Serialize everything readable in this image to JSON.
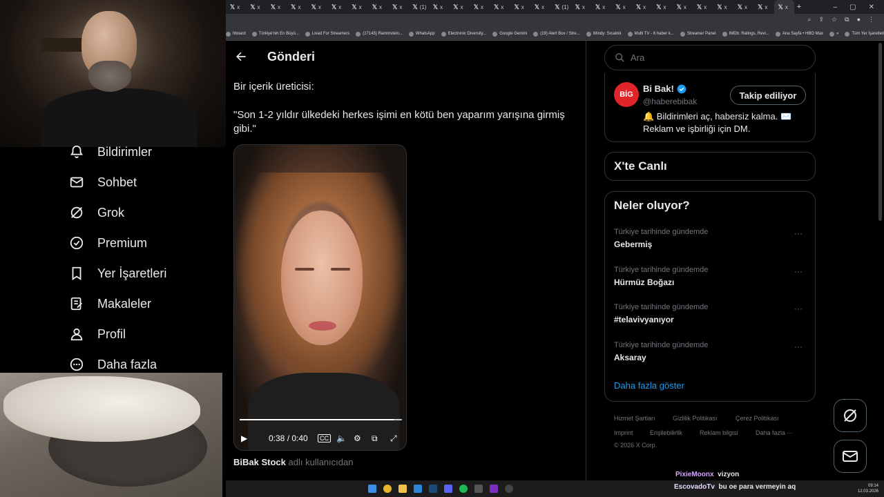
{
  "browser": {
    "tabs": [
      {
        "label": "x"
      },
      {
        "label": "x"
      },
      {
        "label": "x"
      },
      {
        "label": "x"
      },
      {
        "label": "x"
      },
      {
        "label": "x"
      },
      {
        "label": "x"
      },
      {
        "label": "x"
      },
      {
        "label": "x"
      },
      {
        "label": "(1)"
      },
      {
        "label": "x"
      },
      {
        "label": "x"
      },
      {
        "label": "x"
      },
      {
        "label": "x"
      },
      {
        "label": "x"
      },
      {
        "label": "x"
      },
      {
        "label": "(1)"
      },
      {
        "label": "x"
      },
      {
        "label": "x"
      },
      {
        "label": "x"
      },
      {
        "label": "x"
      },
      {
        "label": "x"
      },
      {
        "label": "x"
      },
      {
        "label": "x"
      },
      {
        "label": "x"
      },
      {
        "label": "x"
      },
      {
        "label": "x"
      },
      {
        "label": "x"
      }
    ],
    "bookmarks": [
      "hboard",
      "Türkiye'nin En Büyü...",
      "Livad For Streamers",
      "(17145) Rammstein...",
      "WhatsApp",
      "Electronic Diversity...",
      "Google Gemini",
      "(19) Alert Box / Stre...",
      "Windy: Sıcaklık",
      "Multi TV - 6 haber k...",
      "Streamer Panel",
      "IMDb: Ratings, Revi...",
      "Ana Sayfa • HBO Max",
      "»",
      "Tüm Yer İşaretleri"
    ]
  },
  "nav": {
    "items": [
      {
        "label": "Bildirimler",
        "icon": "bell-icon"
      },
      {
        "label": "Sohbet",
        "icon": "mail-icon"
      },
      {
        "label": "Grok",
        "icon": "grok-icon"
      },
      {
        "label": "Premium",
        "icon": "premium-icon"
      },
      {
        "label": "Yer İşaretleri",
        "icon": "bookmark-icon"
      },
      {
        "label": "Makaleler",
        "icon": "articles-icon"
      },
      {
        "label": "Profil",
        "icon": "profile-icon"
      },
      {
        "label": "Daha fazla",
        "icon": "more-icon"
      }
    ]
  },
  "post": {
    "header": "Gönderi",
    "line1": "Bir içerik üreticisi:",
    "line2": "\"Son 1-2 yıldır ülkedeki herkes işimi en kötü ben yaparım yarışına girmiş gibi.\"",
    "video_time": "0:38 / 0:40",
    "video_progress": 0.95,
    "attrib_user": "BiBak Stock",
    "attrib_text": "adlı kullanıcıdan"
  },
  "sidebar": {
    "search_placeholder": "Ara",
    "account": {
      "logo_text": "BİG BAK!",
      "name": "Bi Bak!",
      "handle": "@haberebibak",
      "bio": "🔔 Bildirimleri aç, habersiz kalma. ✉️ Reklam ve işbirliği için DM.",
      "follow_label": "Takip ediliyor"
    },
    "live_title": "X'te Canlı",
    "trends_title": "Neler oluyor?",
    "trends": [
      {
        "context": "Türkiye tarihinde gündemde",
        "name": "Gebermiş"
      },
      {
        "context": "Türkiye tarihinde gündemde",
        "name": "Hürmüz Boğazı"
      },
      {
        "context": "Türkiye tarihinde gündemde",
        "name": "#telavivyanıyor"
      },
      {
        "context": "Türkiye tarihinde gündemde",
        "name": "Aksaray"
      }
    ],
    "show_more": "Daha fazla göster",
    "footer_links": [
      "Hizmet Şartları",
      "Gizlilik Politikası",
      "Çerez Politikası",
      "Imprint",
      "Erişilebilirlik",
      "Reklam bilgisi",
      "Daha fazla ···"
    ],
    "copyright": "© 2026 X Corp."
  },
  "chat": [
    {
      "user": "PixieMoonx",
      "message": "vizyon",
      "color": "#d7a6ff"
    },
    {
      "user": "EscovadoTv",
      "message": "bu oe para vermeyin aq",
      "color": "#e9d9ff"
    }
  ],
  "taskbar": {
    "time": "09:14",
    "date": "12.03.2026"
  }
}
